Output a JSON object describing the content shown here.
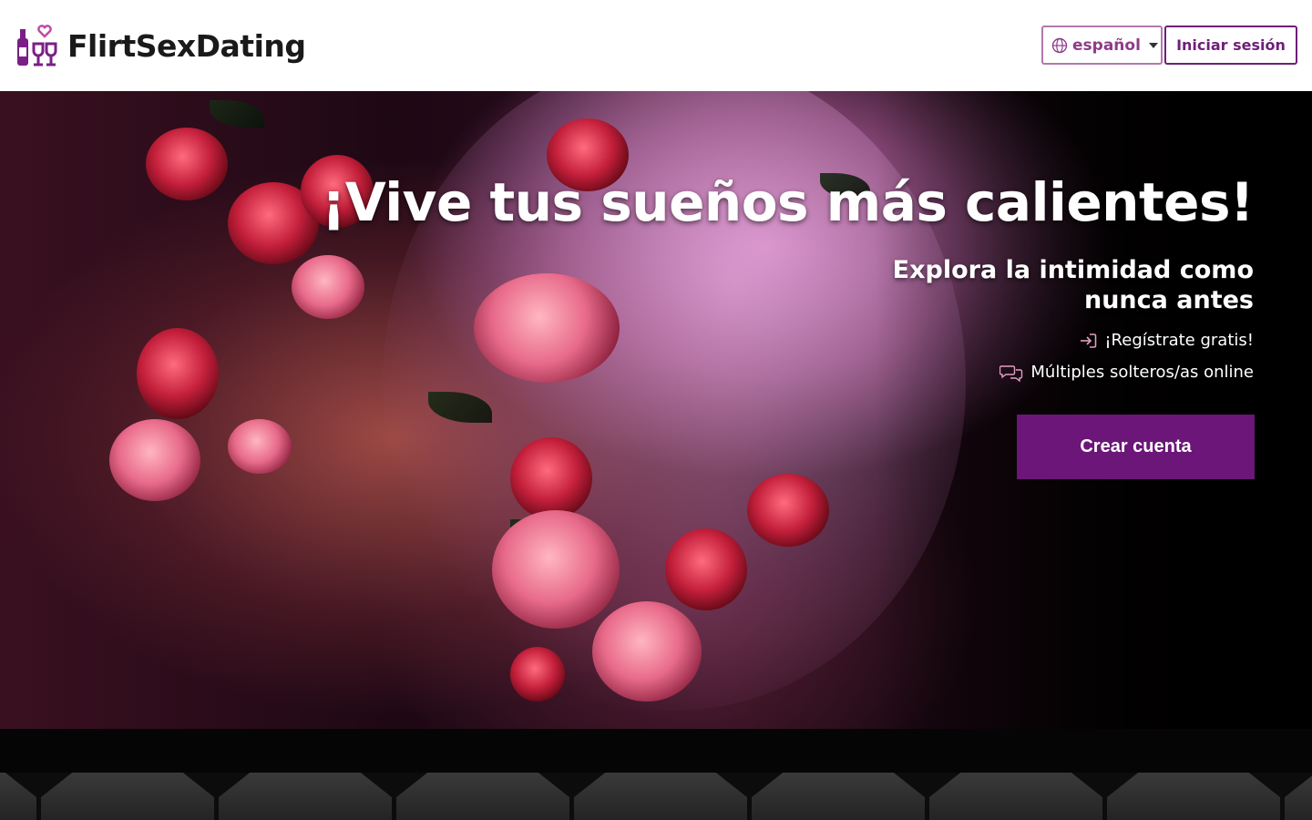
{
  "header": {
    "brand": "FlirtSexDating",
    "logo_icon": "wine-bottle-glasses-heart-icon",
    "language_label": "español",
    "login_label": "Iniciar sesión"
  },
  "hero": {
    "title": "¡Vive tus sueños más calientes!",
    "subtitle": "Explora la intimidad como nunca antes",
    "features": [
      {
        "icon": "sign-in-icon",
        "label": "¡Regístrate gratis!"
      },
      {
        "icon": "chat-bubbles-icon",
        "label": "Múltiples solteros/as online"
      }
    ],
    "cta_label": "Crear cuenta"
  },
  "colors": {
    "brand_purple": "#6b1678",
    "outline_purple": "#6f1f79",
    "lang_border": "#b278ad"
  }
}
